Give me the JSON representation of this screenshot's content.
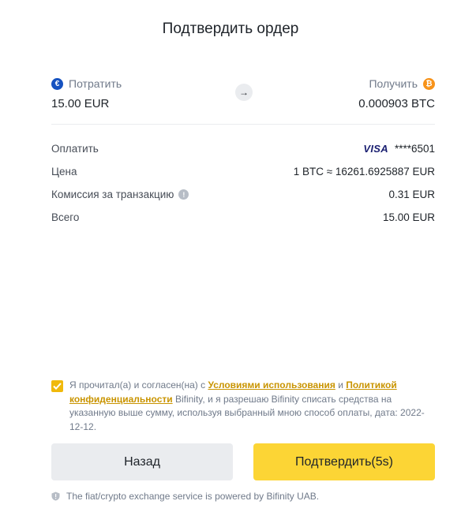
{
  "title": "Подтвердить ордер",
  "spend": {
    "label": "Потратить",
    "amount": "15.00 EUR",
    "coin_symbol": "€"
  },
  "receive": {
    "label": "Получить",
    "amount": "0.000903 BTC",
    "coin_symbol": "₿"
  },
  "swap_arrow": "→",
  "details": {
    "payment": {
      "label": "Оплатить",
      "card_brand": "VISA",
      "card_number": "****6501"
    },
    "price": {
      "label": "Цена",
      "value": "1 BTC ≈ 16261.6925887 EUR"
    },
    "fee": {
      "label": "Комиссия за транзакцию",
      "value": "0.31 EUR"
    },
    "total": {
      "label": "Всего",
      "value": "15.00 EUR"
    }
  },
  "agreement": {
    "checked": true,
    "text_1": "Я прочитал(а) и согласен(на) с ",
    "terms_link": "Условиями использования",
    "text_2": " и ",
    "privacy_link": "Политикой конфиденциальности",
    "text_3": " Bifinity, и я разрешаю Bifinity списать средства на указанную выше сумму, используя выбранный мною способ оплаты, дата: 2022-12-12."
  },
  "buttons": {
    "back": "Назад",
    "confirm": "Подтвердить(5s)"
  },
  "footer": "The fiat/crypto exchange service is powered by Bifinity UAB.",
  "colors": {
    "accent": "#fcd535",
    "link": "#c99400",
    "checkbox": "#f0b90b"
  }
}
